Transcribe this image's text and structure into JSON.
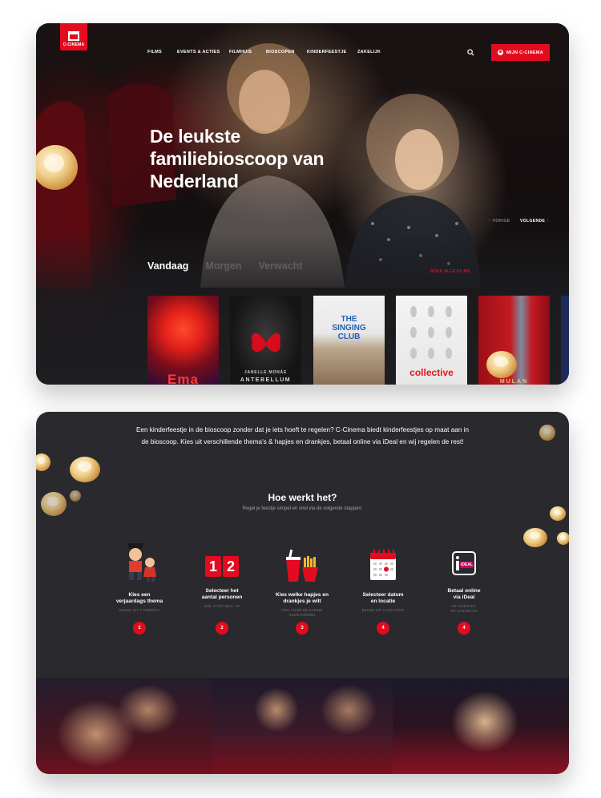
{
  "logo": {
    "text": "C-CINEMA"
  },
  "nav": {
    "items": [
      {
        "label": "Films"
      },
      {
        "label": "Events & Acties"
      },
      {
        "label": "Filmhuis"
      },
      {
        "label": "Bioscopen"
      },
      {
        "label": "Kinderfeestje"
      },
      {
        "label": "Zakelijk"
      }
    ],
    "account_label": "Mijn C-Cinema"
  },
  "hero": {
    "title": "De leukste familiebioscoop van Nederland",
    "prev_label": "Vorige",
    "next_label": "Volgende"
  },
  "schedule": {
    "tabs": [
      {
        "label": "Vandaag",
        "active": true
      },
      {
        "label": "Morgen",
        "active": false
      },
      {
        "label": "Verwacht",
        "active": false
      }
    ],
    "book_all_label": "Boek alle films",
    "posters": [
      {
        "title": "Ema"
      },
      {
        "title": "Antebellum",
        "credit": "Janelle Monáe"
      },
      {
        "title": "The Singing Club"
      },
      {
        "title": "collective"
      },
      {
        "title": "Mulan"
      }
    ]
  },
  "info": {
    "intro": "Een kinderfeestje in de bioscoop zonder dat je iets hoeft te regelen? C-Cinema biedt kinderfeestjes op maat aan in de bioscoop. Kies uit verschillende thema's & hapjes en drankjes, betaal online via iDeal en wij regelen de rest!",
    "how_title": "Hoe werkt het?",
    "how_subtitle": "Regel je feestje simpel en snel via de volgende stappen;",
    "steps": [
      {
        "title": "Kies een\nverjaardags thema",
        "note": "Keuze uit 7 thema's",
        "number": "1",
        "icon": "pirate-kids-icon"
      },
      {
        "title": "Selecteer het\naantal personen",
        "note": "Min. 6 tot max. 40",
        "number": "2",
        "icon": "number-blocks-icon"
      },
      {
        "title": "Kies welke hapjes en\ndrankjes je wilt",
        "note": "Ook voor de kleine\nvegetariërs",
        "number": "3",
        "icon": "fries-drink-icon"
      },
      {
        "title": "Selecteer datum\nen locatie",
        "note": "Keuze uit 3 locaties",
        "number": "4",
        "icon": "calendar-icon"
      },
      {
        "title": "Betaal online\nvia iDeal",
        "note": "Of contact\nop aanvraag",
        "number": "4",
        "icon": "ideal-icon"
      }
    ],
    "number_blocks": [
      "1",
      "2"
    ],
    "ideal_text": "iDEAL"
  },
  "colors": {
    "brand_red": "#e30b1f",
    "dark_card": "#2a292d",
    "hero_dark": "#1e1d20"
  }
}
